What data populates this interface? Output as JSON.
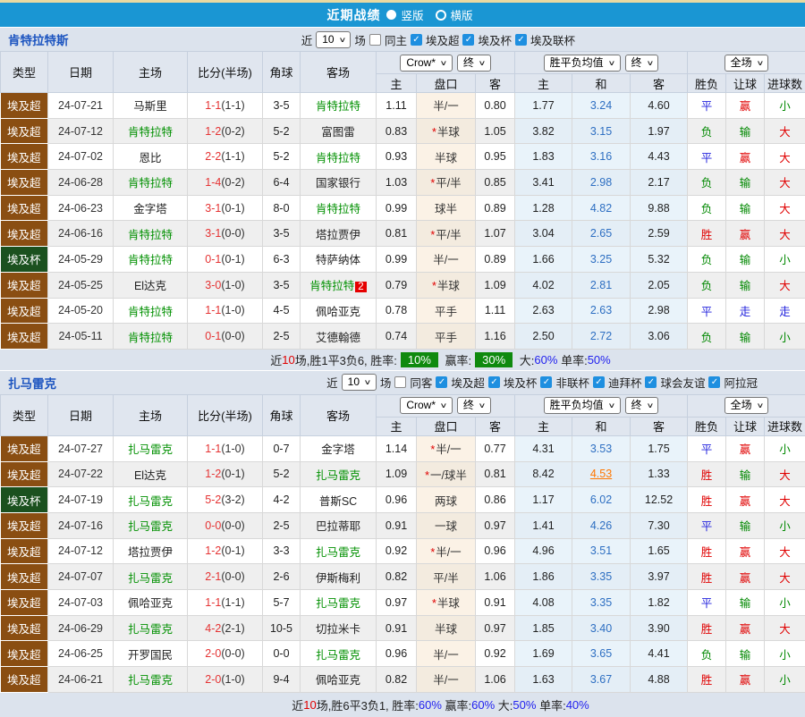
{
  "title_bar": {
    "title": "近期战绩",
    "options": [
      {
        "label": "竖版",
        "selected": true
      },
      {
        "label": "横版",
        "selected": false
      }
    ]
  },
  "icons": {
    "check": "✓",
    "chevron": "∨"
  },
  "columns": {
    "type": "类型",
    "date": "日期",
    "home": "主场",
    "score": "比分(半场)",
    "corner": "角球",
    "away": "客场",
    "asian_home": "主",
    "handicap": "盘口",
    "asian_away": "客",
    "euro_home": "主",
    "euro_draw": "和",
    "euro_away": "客",
    "result": "胜负",
    "handicap_result": "让球",
    "goals": "进球数"
  },
  "dropdowns": {
    "company": "Crow*",
    "final1": "终",
    "euro": "胜平负均值",
    "final2": "终",
    "scope": "全场"
  },
  "type_colors": {
    "埃及超": "#8a4e12",
    "埃及杯": "#1b511f"
  },
  "value_colors": {
    "胜": "#e00000",
    "平": "#2222dd",
    "负": "#008800",
    "赢": "#e00000",
    "走": "#2222dd",
    "输": "#008800",
    "大": "#e00000",
    "小": "#008800"
  },
  "sections": [
    {
      "team": "肯特拉特斯",
      "filters": {
        "near": "近",
        "count": "10",
        "games": "场",
        "same": "同主",
        "leagues": [
          "埃及超",
          "埃及杯",
          "埃及联杯"
        ]
      },
      "rows": [
        {
          "lg": "埃及超",
          "dt": "24-07-21",
          "hm": "马斯里",
          "hmHl": 0,
          "sc": "1-1",
          "hf": "(1-1)",
          "cn": "3-5",
          "aw": "肯特拉特",
          "awHl": 1,
          "awBadge": "",
          "h1": "1.11",
          "star": 0,
          "hc": "半/一",
          "h2": "0.80",
          "e1": "1.77",
          "e2": "3.24",
          "e3": "4.60",
          "e2hl": 0,
          "r1": "平",
          "r2": "赢",
          "r3": "小"
        },
        {
          "lg": "埃及超",
          "dt": "24-07-12",
          "hm": "肯特拉特",
          "hmHl": 1,
          "sc": "1-2",
          "hf": "(0-2)",
          "cn": "5-2",
          "aw": "富图雷",
          "awHl": 0,
          "awBadge": "",
          "h1": "0.83",
          "star": 1,
          "hc": "半球",
          "h2": "1.05",
          "e1": "3.82",
          "e2": "3.15",
          "e3": "1.97",
          "e2hl": 0,
          "r1": "负",
          "r2": "输",
          "r3": "大"
        },
        {
          "lg": "埃及超",
          "dt": "24-07-02",
          "hm": "恩比",
          "hmHl": 0,
          "sc": "2-2",
          "hf": "(1-1)",
          "cn": "5-2",
          "aw": "肯特拉特",
          "awHl": 1,
          "awBadge": "",
          "h1": "0.93",
          "star": 0,
          "hc": "半球",
          "h2": "0.95",
          "e1": "1.83",
          "e2": "3.16",
          "e3": "4.43",
          "e2hl": 0,
          "r1": "平",
          "r2": "赢",
          "r3": "大"
        },
        {
          "lg": "埃及超",
          "dt": "24-06-28",
          "hm": "肯特拉特",
          "hmHl": 1,
          "sc": "1-4",
          "hf": "(0-2)",
          "cn": "6-4",
          "aw": "国家银行",
          "awHl": 0,
          "awBadge": "",
          "h1": "1.03",
          "star": 1,
          "hc": "平/半",
          "h2": "0.85",
          "e1": "3.41",
          "e2": "2.98",
          "e3": "2.17",
          "e2hl": 0,
          "r1": "负",
          "r2": "输",
          "r3": "大"
        },
        {
          "lg": "埃及超",
          "dt": "24-06-23",
          "hm": "金字塔",
          "hmHl": 0,
          "sc": "3-1",
          "hf": "(0-1)",
          "cn": "8-0",
          "aw": "肯特拉特",
          "awHl": 1,
          "awBadge": "",
          "h1": "0.99",
          "star": 0,
          "hc": "球半",
          "h2": "0.89",
          "e1": "1.28",
          "e2": "4.82",
          "e3": "9.88",
          "e2hl": 0,
          "r1": "负",
          "r2": "输",
          "r3": "大"
        },
        {
          "lg": "埃及超",
          "dt": "24-06-16",
          "hm": "肯特拉特",
          "hmHl": 1,
          "sc": "3-1",
          "hf": "(0-0)",
          "cn": "3-5",
          "aw": "塔拉贾伊",
          "awHl": 0,
          "awBadge": "",
          "h1": "0.81",
          "star": 1,
          "hc": "平/半",
          "h2": "1.07",
          "e1": "3.04",
          "e2": "2.65",
          "e3": "2.59",
          "e2hl": 0,
          "r1": "胜",
          "r2": "赢",
          "r3": "大"
        },
        {
          "lg": "埃及杯",
          "dt": "24-05-29",
          "hm": "肯特拉特",
          "hmHl": 1,
          "sc": "0-1",
          "hf": "(0-1)",
          "cn": "6-3",
          "aw": "特萨纳体",
          "awHl": 0,
          "awBadge": "",
          "h1": "0.99",
          "star": 0,
          "hc": "半/一",
          "h2": "0.89",
          "e1": "1.66",
          "e2": "3.25",
          "e3": "5.32",
          "e2hl": 0,
          "r1": "负",
          "r2": "输",
          "r3": "小"
        },
        {
          "lg": "埃及超",
          "dt": "24-05-25",
          "hm": "El达克",
          "hmHl": 0,
          "sc": "3-0",
          "hf": "(1-0)",
          "cn": "3-5",
          "aw": "肯特拉特",
          "awHl": 1,
          "awBadge": "2",
          "h1": "0.79",
          "star": 1,
          "hc": "半球",
          "h2": "1.09",
          "e1": "4.02",
          "e2": "2.81",
          "e3": "2.05",
          "e2hl": 0,
          "r1": "负",
          "r2": "输",
          "r3": "大"
        },
        {
          "lg": "埃及超",
          "dt": "24-05-20",
          "hm": "肯特拉特",
          "hmHl": 1,
          "sc": "1-1",
          "hf": "(1-0)",
          "cn": "4-5",
          "aw": "佩哈亚克",
          "awHl": 0,
          "awBadge": "",
          "h1": "0.78",
          "star": 0,
          "hc": "平手",
          "h2": "1.11",
          "e1": "2.63",
          "e2": "2.63",
          "e3": "2.98",
          "e2hl": 0,
          "r1": "平",
          "r2": "走",
          "r3": "走"
        },
        {
          "lg": "埃及超",
          "dt": "24-05-11",
          "hm": "肯特拉特",
          "hmHl": 1,
          "sc": "0-1",
          "hf": "(0-0)",
          "cn": "2-5",
          "aw": "艾德翰德",
          "awHl": 0,
          "awBadge": "",
          "h1": "0.74",
          "star": 0,
          "hc": "平手",
          "h2": "1.16",
          "e1": "2.50",
          "e2": "2.72",
          "e3": "3.06",
          "e2hl": 0,
          "r1": "负",
          "r2": "输",
          "r3": "小"
        }
      ],
      "summary_parts": [
        {
          "t": "近"
        },
        {
          "t": "10",
          "c": "red"
        },
        {
          "t": "场,胜1平3负6, 胜率:"
        },
        {
          "t": "10%",
          "c": "badge"
        },
        {
          "t": " 赢率:"
        },
        {
          "t": "30%",
          "c": "badge"
        },
        {
          "t": " 大:"
        },
        {
          "t": "60%",
          "c": "blue"
        },
        {
          "t": " 单率:"
        },
        {
          "t": "50%",
          "c": "blue"
        }
      ]
    },
    {
      "team": "扎马雷克",
      "filters": {
        "near": "近",
        "count": "10",
        "games": "场",
        "same": "同客",
        "leagues": [
          "埃及超",
          "埃及杯",
          "非联杯",
          "迪拜杯",
          "球会友谊",
          "阿拉冠"
        ]
      },
      "rows": [
        {
          "lg": "埃及超",
          "dt": "24-07-27",
          "hm": "扎马雷克",
          "hmHl": 1,
          "sc": "1-1",
          "hf": "(1-0)",
          "cn": "0-7",
          "aw": "金字塔",
          "awHl": 0,
          "awBadge": "",
          "h1": "1.14",
          "star": 1,
          "hc": "半/一",
          "h2": "0.77",
          "e1": "4.31",
          "e2": "3.53",
          "e3": "1.75",
          "e2hl": 0,
          "r1": "平",
          "r2": "赢",
          "r3": "小"
        },
        {
          "lg": "埃及超",
          "dt": "24-07-22",
          "hm": "El达克",
          "hmHl": 0,
          "sc": "1-2",
          "hf": "(0-1)",
          "cn": "5-2",
          "aw": "扎马雷克",
          "awHl": 1,
          "awBadge": "",
          "h1": "1.09",
          "star": 1,
          "hc": "一/球半",
          "h2": "0.81",
          "e1": "8.42",
          "e2": "4.53",
          "e3": "1.33",
          "e2hl": 1,
          "r1": "胜",
          "r2": "输",
          "r3": "大"
        },
        {
          "lg": "埃及杯",
          "dt": "24-07-19",
          "hm": "扎马雷克",
          "hmHl": 1,
          "sc": "5-2",
          "hf": "(3-2)",
          "cn": "4-2",
          "aw": "普斯SC",
          "awHl": 0,
          "awBadge": "",
          "h1": "0.96",
          "star": 0,
          "hc": "两球",
          "h2": "0.86",
          "e1": "1.17",
          "e2": "6.02",
          "e3": "12.52",
          "e2hl": 0,
          "r1": "胜",
          "r2": "赢",
          "r3": "大"
        },
        {
          "lg": "埃及超",
          "dt": "24-07-16",
          "hm": "扎马雷克",
          "hmHl": 1,
          "sc": "0-0",
          "hf": "(0-0)",
          "cn": "2-5",
          "aw": "巴拉蒂耶",
          "awHl": 0,
          "awBadge": "",
          "h1": "0.91",
          "star": 0,
          "hc": "一球",
          "h2": "0.97",
          "e1": "1.41",
          "e2": "4.26",
          "e3": "7.30",
          "e2hl": 0,
          "r1": "平",
          "r2": "输",
          "r3": "小"
        },
        {
          "lg": "埃及超",
          "dt": "24-07-12",
          "hm": "塔拉贾伊",
          "hmHl": 0,
          "sc": "1-2",
          "hf": "(0-1)",
          "cn": "3-3",
          "aw": "扎马雷克",
          "awHl": 1,
          "awBadge": "",
          "h1": "0.92",
          "star": 1,
          "hc": "半/一",
          "h2": "0.96",
          "e1": "4.96",
          "e2": "3.51",
          "e3": "1.65",
          "e2hl": 0,
          "r1": "胜",
          "r2": "赢",
          "r3": "大"
        },
        {
          "lg": "埃及超",
          "dt": "24-07-07",
          "hm": "扎马雷克",
          "hmHl": 1,
          "sc": "2-1",
          "hf": "(0-0)",
          "cn": "2-6",
          "aw": "伊斯梅利",
          "awHl": 0,
          "awBadge": "",
          "h1": "0.82",
          "star": 0,
          "hc": "平/半",
          "h2": "1.06",
          "e1": "1.86",
          "e2": "3.35",
          "e3": "3.97",
          "e2hl": 0,
          "r1": "胜",
          "r2": "赢",
          "r3": "大"
        },
        {
          "lg": "埃及超",
          "dt": "24-07-03",
          "hm": "佩哈亚克",
          "hmHl": 0,
          "sc": "1-1",
          "hf": "(1-1)",
          "cn": "5-7",
          "aw": "扎马雷克",
          "awHl": 1,
          "awBadge": "",
          "h1": "0.97",
          "star": 1,
          "hc": "半球",
          "h2": "0.91",
          "e1": "4.08",
          "e2": "3.35",
          "e3": "1.82",
          "e2hl": 0,
          "r1": "平",
          "r2": "输",
          "r3": "小"
        },
        {
          "lg": "埃及超",
          "dt": "24-06-29",
          "hm": "扎马雷克",
          "hmHl": 1,
          "sc": "4-2",
          "hf": "(2-1)",
          "cn": "10-5",
          "aw": "切拉米卡",
          "awHl": 0,
          "awBadge": "",
          "h1": "0.91",
          "star": 0,
          "hc": "半球",
          "h2": "0.97",
          "e1": "1.85",
          "e2": "3.40",
          "e3": "3.90",
          "e2hl": 0,
          "r1": "胜",
          "r2": "赢",
          "r3": "大"
        },
        {
          "lg": "埃及超",
          "dt": "24-06-25",
          "hm": "开罗国民",
          "hmHl": 0,
          "sc": "2-0",
          "hf": "(0-0)",
          "cn": "0-0",
          "aw": "扎马雷克",
          "awHl": 1,
          "awBadge": "",
          "h1": "0.96",
          "star": 0,
          "hc": "半/一",
          "h2": "0.92",
          "e1": "1.69",
          "e2": "3.65",
          "e3": "4.41",
          "e2hl": 0,
          "r1": "负",
          "r2": "输",
          "r3": "小"
        },
        {
          "lg": "埃及超",
          "dt": "24-06-21",
          "hm": "扎马雷克",
          "hmHl": 1,
          "sc": "2-0",
          "hf": "(1-0)",
          "cn": "9-4",
          "aw": "佩哈亚克",
          "awHl": 0,
          "awBadge": "",
          "h1": "0.82",
          "star": 0,
          "hc": "半/一",
          "h2": "1.06",
          "e1": "1.63",
          "e2": "3.67",
          "e3": "4.88",
          "e2hl": 0,
          "r1": "胜",
          "r2": "赢",
          "r3": "小"
        }
      ],
      "summary_parts": [
        {
          "t": "近"
        },
        {
          "t": "10",
          "c": "red"
        },
        {
          "t": "场,胜6平3负1, 胜率:"
        },
        {
          "t": "60%",
          "c": "blue"
        },
        {
          "t": " 赢率:"
        },
        {
          "t": "60%",
          "c": "blue"
        },
        {
          "t": " 大:"
        },
        {
          "t": "50%",
          "c": "blue"
        },
        {
          "t": " 单率:"
        },
        {
          "t": "40%",
          "c": "blue"
        }
      ]
    }
  ]
}
